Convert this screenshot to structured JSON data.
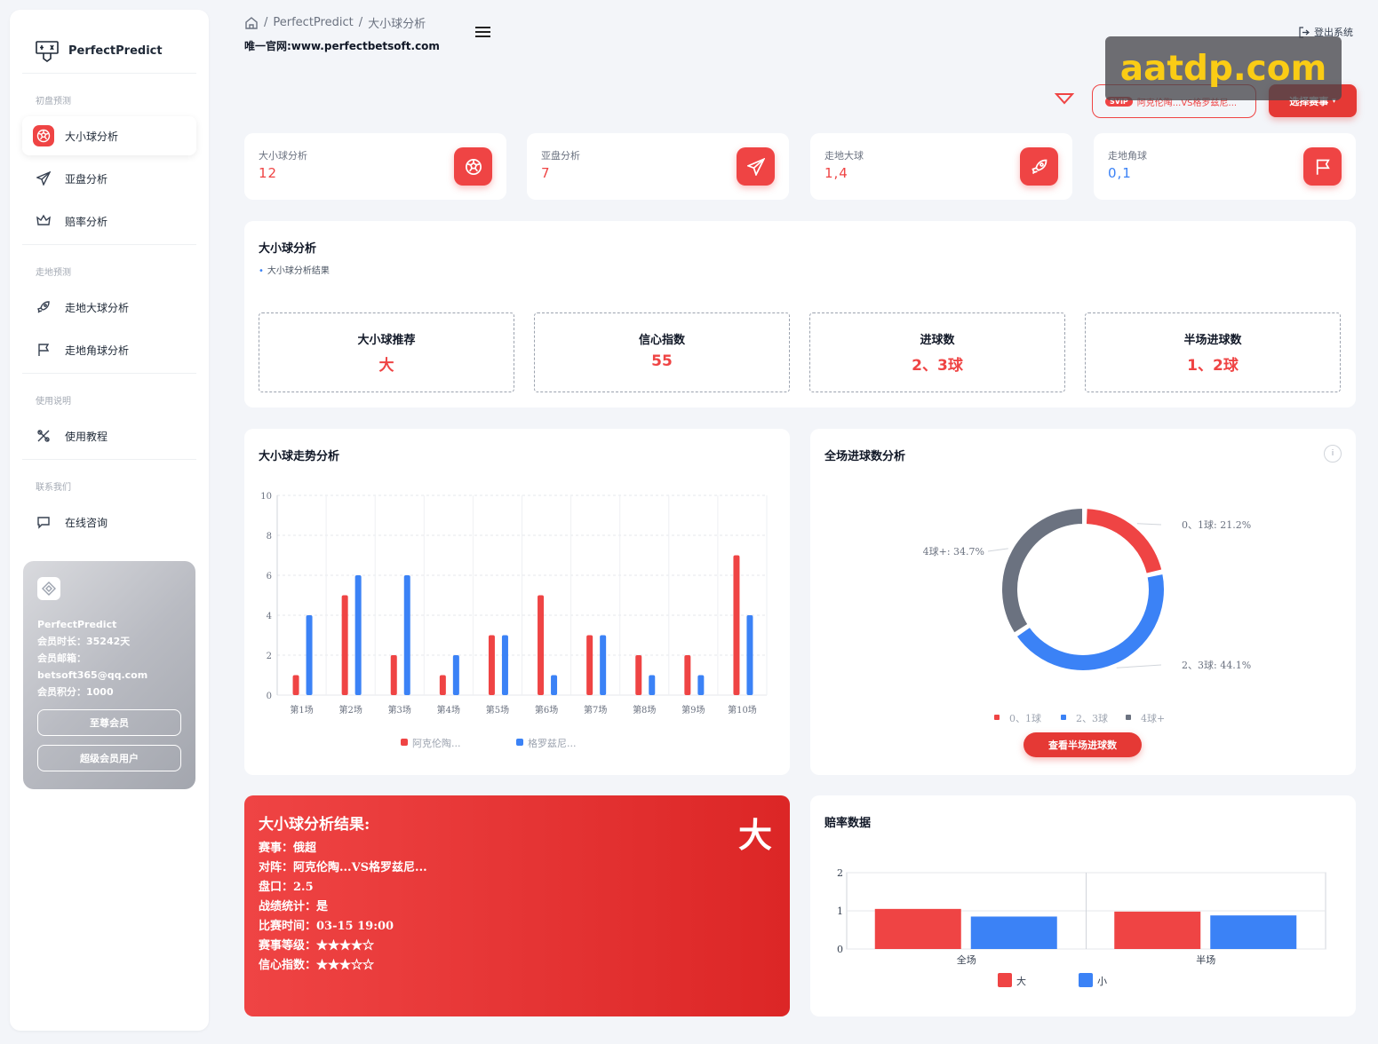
{
  "app": {
    "name": "PerfectPredict"
  },
  "sidebar": {
    "sections": [
      {
        "title": "初盘预测",
        "items": [
          {
            "label": "大小球分析",
            "icon": "soccer-ball-icon",
            "active": true
          },
          {
            "label": "亚盘分析",
            "icon": "paper-plane-icon"
          },
          {
            "label": "赔率分析",
            "icon": "crown-icon"
          }
        ]
      },
      {
        "title": "走地预测",
        "items": [
          {
            "label": "走地大球分析",
            "icon": "rocket-icon"
          },
          {
            "label": "走地角球分析",
            "icon": "flag-icon"
          }
        ]
      },
      {
        "title": "使用说明",
        "items": [
          {
            "label": "使用教程",
            "icon": "tools-icon"
          }
        ]
      },
      {
        "title": "联系我们",
        "items": [
          {
            "label": "在线咨询",
            "icon": "chat-icon"
          }
        ]
      }
    ],
    "member": {
      "name": "PerfectPredict",
      "duration": "会员时长：35242天",
      "email_label": "会员邮箱：",
      "email": "betsoft365@qq.com",
      "points": "会员积分：1000",
      "btn_vip": "至尊会员",
      "btn_super": "超级会员用户"
    }
  },
  "header": {
    "breadcrumb": [
      "PerfectPredict",
      "大小球分析"
    ],
    "subtitle": "唯一官网:www.perfectbetsoft.com",
    "logout": "登出系统",
    "watermark": "aatdp.com",
    "match_badge": "SVIP",
    "match_text": "阿克伦陶...VS格罗兹尼...",
    "select_btn": "选择赛事"
  },
  "stats": [
    {
      "label": "大小球分析",
      "value": "12",
      "icon": "soccer-ball-icon",
      "color": "red"
    },
    {
      "label": "亚盘分析",
      "value": "7",
      "icon": "paper-plane-icon",
      "color": "red"
    },
    {
      "label": "走地大球",
      "value": "1,4",
      "icon": "rocket-icon",
      "color": "red"
    },
    {
      "label": "走地角球",
      "value": "0,1",
      "icon": "flag-icon",
      "color": "blue"
    }
  ],
  "analysis": {
    "title": "大小球分析",
    "subtitle": "大小球分析结果",
    "boxes": [
      {
        "title": "大小球推荐",
        "value": "大"
      },
      {
        "title": "信心指数",
        "value": "55"
      },
      {
        "title": "进球数",
        "value": "2、3球"
      },
      {
        "title": "半场进球数",
        "value": "1、2球"
      }
    ]
  },
  "trend": {
    "title": "大小球走势分析",
    "chart_data": {
      "type": "bar",
      "categories": [
        "第1场",
        "第2场",
        "第3场",
        "第4场",
        "第5场",
        "第6场",
        "第7场",
        "第8场",
        "第9场",
        "第10场"
      ],
      "series": [
        {
          "name": "阿克伦陶...",
          "color": "#ef4444",
          "values": [
            1,
            5,
            2,
            1,
            3,
            5,
            3,
            2,
            2,
            7
          ]
        },
        {
          "name": "格罗兹尼...",
          "color": "#3b82f6",
          "values": [
            4,
            6,
            6,
            2,
            3,
            1,
            3,
            1,
            1,
            4
          ]
        }
      ],
      "ylim": [
        0,
        10
      ],
      "yticks": [
        0,
        2,
        4,
        6,
        8,
        10
      ]
    }
  },
  "goals": {
    "title": "全场进球数分析",
    "info": "i",
    "button": "查看半场进球数",
    "chart_data": {
      "type": "pie",
      "slices": [
        {
          "name": "0、1球",
          "value": 21.2,
          "color": "#ef4444",
          "label": "0、1球: 21.2%"
        },
        {
          "name": "2、3球",
          "value": 44.1,
          "color": "#3b82f6",
          "label": "2、3球: 44.1%"
        },
        {
          "name": "4球+",
          "value": 34.7,
          "color": "#6b7280",
          "label": "4球+: 34.7%"
        }
      ]
    }
  },
  "result": {
    "title": "大小球分析结果:",
    "big": "大",
    "lines": [
      "赛事：俄超",
      "对阵：阿克伦陶...VS格罗兹尼...",
      "盘口：2.5",
      "战绩统计：是",
      "比赛时间：03-15 19:00",
      "赛事等级：★★★★☆",
      "信心指数：★★★☆☆"
    ]
  },
  "odds": {
    "title": "赔率数据",
    "chart_data": {
      "type": "bar",
      "categories": [
        "全场",
        "半场"
      ],
      "series": [
        {
          "name": "大",
          "color": "#ef4444",
          "values": [
            1.05,
            0.98
          ]
        },
        {
          "name": "小",
          "color": "#3b82f6",
          "values": [
            0.85,
            0.88
          ]
        }
      ],
      "ylim": [
        0,
        2
      ],
      "yticks": [
        0,
        1,
        2
      ]
    }
  }
}
